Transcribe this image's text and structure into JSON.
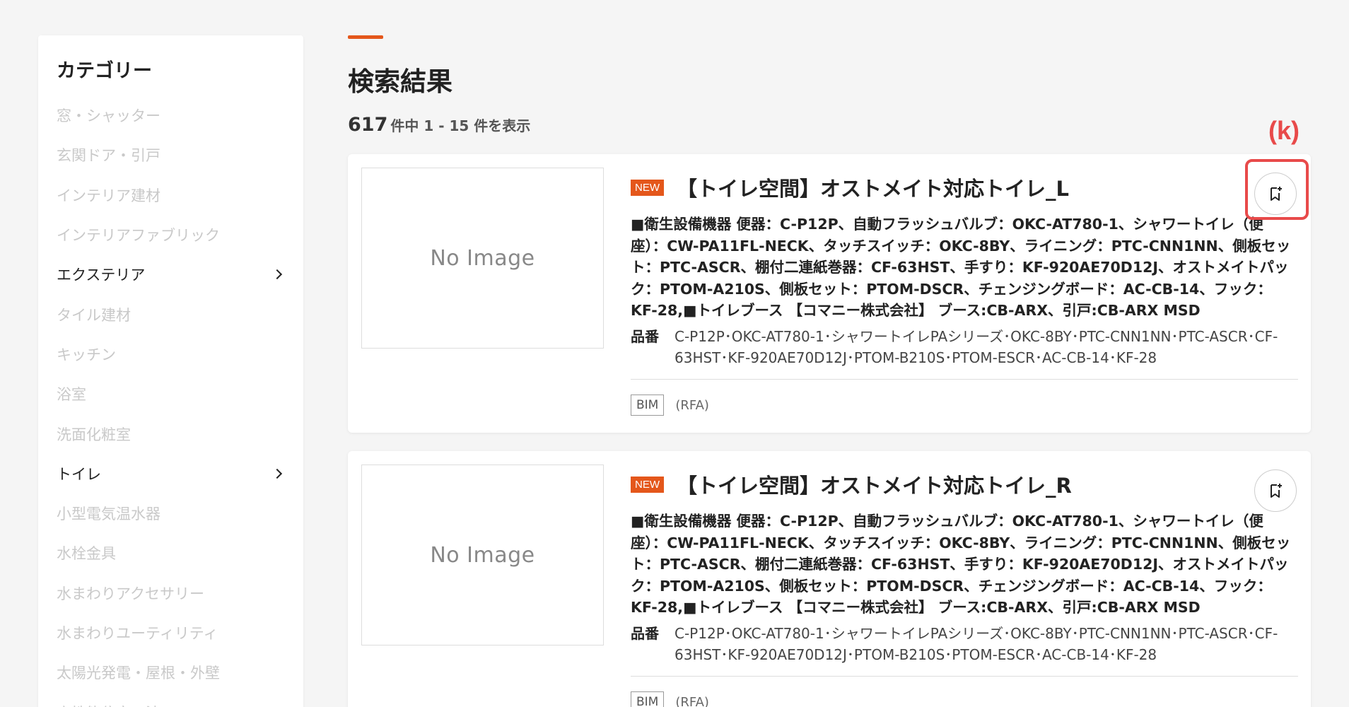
{
  "sidebar": {
    "title": "カテゴリー",
    "items": [
      {
        "label": "窓・シャッター",
        "active": false
      },
      {
        "label": "玄関ドア・引戸",
        "active": false
      },
      {
        "label": "インテリア建材",
        "active": false
      },
      {
        "label": "インテリアファブリック",
        "active": false
      },
      {
        "label": "エクステリア",
        "active": true
      },
      {
        "label": "タイル建材",
        "active": false
      },
      {
        "label": "キッチン",
        "active": false
      },
      {
        "label": "浴室",
        "active": false
      },
      {
        "label": "洗面化粧室",
        "active": false
      },
      {
        "label": "トイレ",
        "active": true
      },
      {
        "label": "小型電気温水器",
        "active": false
      },
      {
        "label": "水栓金具",
        "active": false
      },
      {
        "label": "水まわりアクセサリー",
        "active": false
      },
      {
        "label": "水まわりユーティリティ",
        "active": false
      },
      {
        "label": "太陽光発電・屋根・外壁",
        "active": false
      },
      {
        "label": "高性能住宅工法",
        "active": false
      }
    ]
  },
  "main": {
    "title": "検索結果",
    "count_total": "617",
    "count_text": "件中 1 - 15 件を表示"
  },
  "annotation_label": "(k)",
  "results": [
    {
      "image_text": "No Image",
      "badge": "NEW",
      "title": "【トイレ空間】オストメイト対応トイレ_L",
      "description": "■衛生設備機器 便器：C-P12P、自動フラッシュバルブ：OKC-AT780-1、シャワートイレ（便座）：CW-PA11FL-NECK、タッチスイッチ：OKC-8BY、ライニング：PTC-CNN1NN、側板セット：PTC-ASCR、棚付二連紙巻器：CF-63HST、手すり：KF-920AE70D12J、オストメイトパック：PTOM-A210S、側板セット：PTOM-DSCR、チェンジングボード：AC-CB-14、フック：KF-28,■トイレブース 【コマニー株式会社】 ブース:CB-ARX、引戸:CB-ARX MSD",
      "part_label": "品番",
      "part_numbers": "C-P12P･OKC-AT780-1･シャワートイレPAシリーズ･OKC-8BY･PTC-CNN1NN･PTC-ASCR･CF-63HST･KF-920AE70D12J･PTOM-B210S･PTOM-ESCR･AC-CB-14･KF-28",
      "tag": "BIM",
      "format": "(RFA)"
    },
    {
      "image_text": "No Image",
      "badge": "NEW",
      "title": "【トイレ空間】オストメイト対応トイレ_R",
      "description": "■衛生設備機器 便器：C-P12P、自動フラッシュバルブ：OKC-AT780-1、シャワートイレ（便座）：CW-PA11FL-NECK、タッチスイッチ：OKC-8BY、ライニング：PTC-CNN1NN、側板セット：PTC-ASCR、棚付二連紙巻器：CF-63HST、手すり：KF-920AE70D12J、オストメイトパック：PTOM-A210S、側板セット：PTOM-DSCR、チェンジングボード：AC-CB-14、フック：KF-28,■トイレブース 【コマニー株式会社】 ブース:CB-ARX、引戸:CB-ARX MSD",
      "part_label": "品番",
      "part_numbers": "C-P12P･OKC-AT780-1･シャワートイレPAシリーズ･OKC-8BY･PTC-CNN1NN･PTC-ASCR･CF-63HST･KF-920AE70D12J･PTOM-B210S･PTOM-ESCR･AC-CB-14･KF-28",
      "tag": "BIM",
      "format": "(RFA)"
    }
  ],
  "colors": {
    "accent": "#e4571b",
    "annotation": "#e84a4a",
    "inactive_text": "#c9c9c9"
  }
}
